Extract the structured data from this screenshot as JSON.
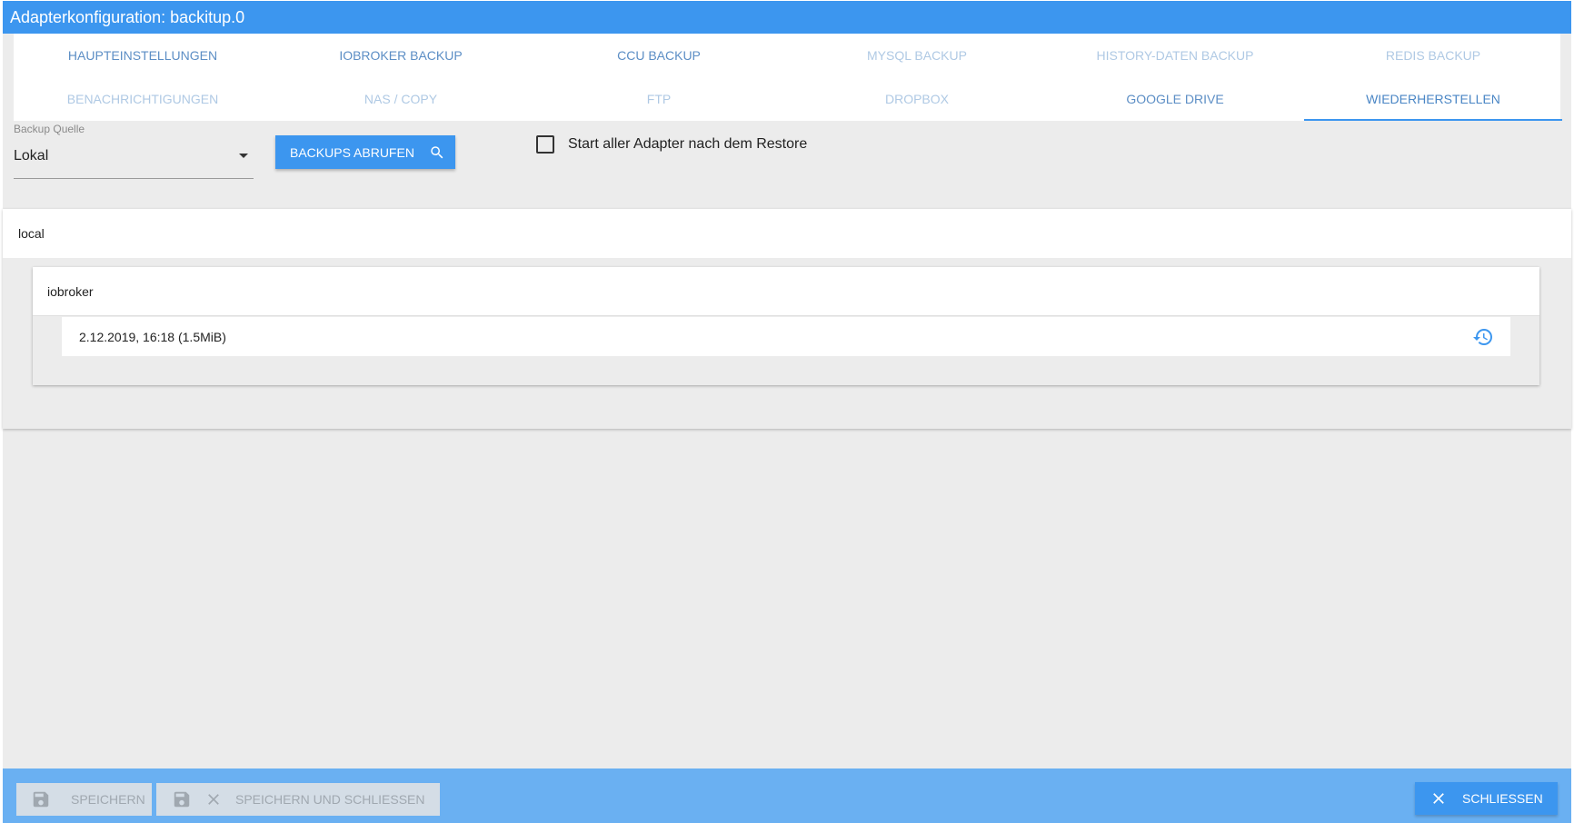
{
  "window": {
    "title": "Adapterkonfiguration: backitup.0"
  },
  "tabs": [
    {
      "label": "HAUPTEINSTELLUNGEN",
      "state": "enabled"
    },
    {
      "label": "IOBROKER BACKUP",
      "state": "enabled"
    },
    {
      "label": "CCU BACKUP",
      "state": "enabled"
    },
    {
      "label": "MYSQL BACKUP",
      "state": "disabled"
    },
    {
      "label": "HISTORY-DATEN BACKUP",
      "state": "disabled"
    },
    {
      "label": "REDIS BACKUP",
      "state": "disabled"
    },
    {
      "label": "BENACHRICHTIGUNGEN",
      "state": "disabled"
    },
    {
      "label": "NAS / COPY",
      "state": "disabled"
    },
    {
      "label": "FTP",
      "state": "disabled"
    },
    {
      "label": "DROPBOX",
      "state": "disabled"
    },
    {
      "label": "GOOGLE DRIVE",
      "state": "enabled"
    },
    {
      "label": "WIEDERHERSTELLEN",
      "state": "active"
    }
  ],
  "restore": {
    "source_label": "Backup Quelle",
    "source_value": "Lokal",
    "fetch_button": "BACKUPS ABRUFEN",
    "start_adapters_label": "Start aller Adapter nach dem Restore",
    "start_adapters_checked": false
  },
  "backups": {
    "location": "local",
    "group": "iobroker",
    "items": [
      {
        "label": "2.12.2019, 16:18 (1.5MiB)"
      }
    ]
  },
  "footer": {
    "save": "SPEICHERN",
    "save_close": "SPEICHERN UND SCHLIESSEN",
    "close": "SCHLIESSEN"
  },
  "colors": {
    "accent": "#3c96ef",
    "footer": "#6ab0f2",
    "background": "#ececec"
  },
  "icons": {
    "select": "chevron-down-icon",
    "fetch": "search-icon",
    "restore": "history-icon",
    "save": "floppy-disk-icon",
    "close": "close-icon"
  }
}
